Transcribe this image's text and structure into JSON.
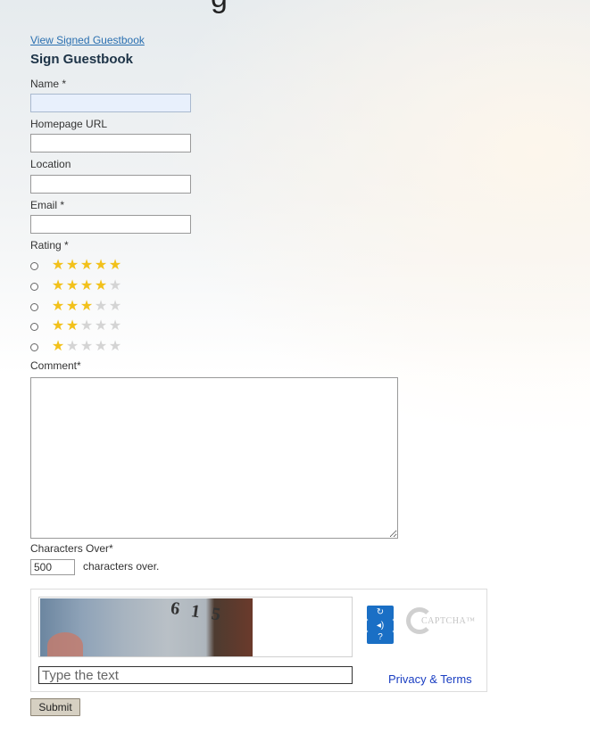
{
  "page_title_fragment": "g",
  "view_link": "View Signed Guestbook",
  "heading": "Sign Guestbook",
  "fields": {
    "name_label": "Name *",
    "homepage_label": "Homepage URL",
    "location_label": "Location",
    "email_label": "Email *",
    "rating_label": "Rating *",
    "comment_label": "Comment*"
  },
  "rating_options": [
    5,
    4,
    3,
    2,
    1
  ],
  "counter": {
    "label": "Characters Over*",
    "value": "500",
    "suffix": "characters over."
  },
  "captcha": {
    "image_text": "6 1 5",
    "placeholder": "Type the text",
    "privacy": "Privacy & Terms",
    "logo_text": "CAPTCHA™",
    "buttons": [
      "refresh-icon",
      "audio-icon",
      "help-icon"
    ]
  },
  "submit_label": "Submit",
  "colors": {
    "star_on": "#f2c11b",
    "star_off": "#d4d4d4",
    "link": "#2a6fb0",
    "captcha_button": "#1a6fc5"
  }
}
